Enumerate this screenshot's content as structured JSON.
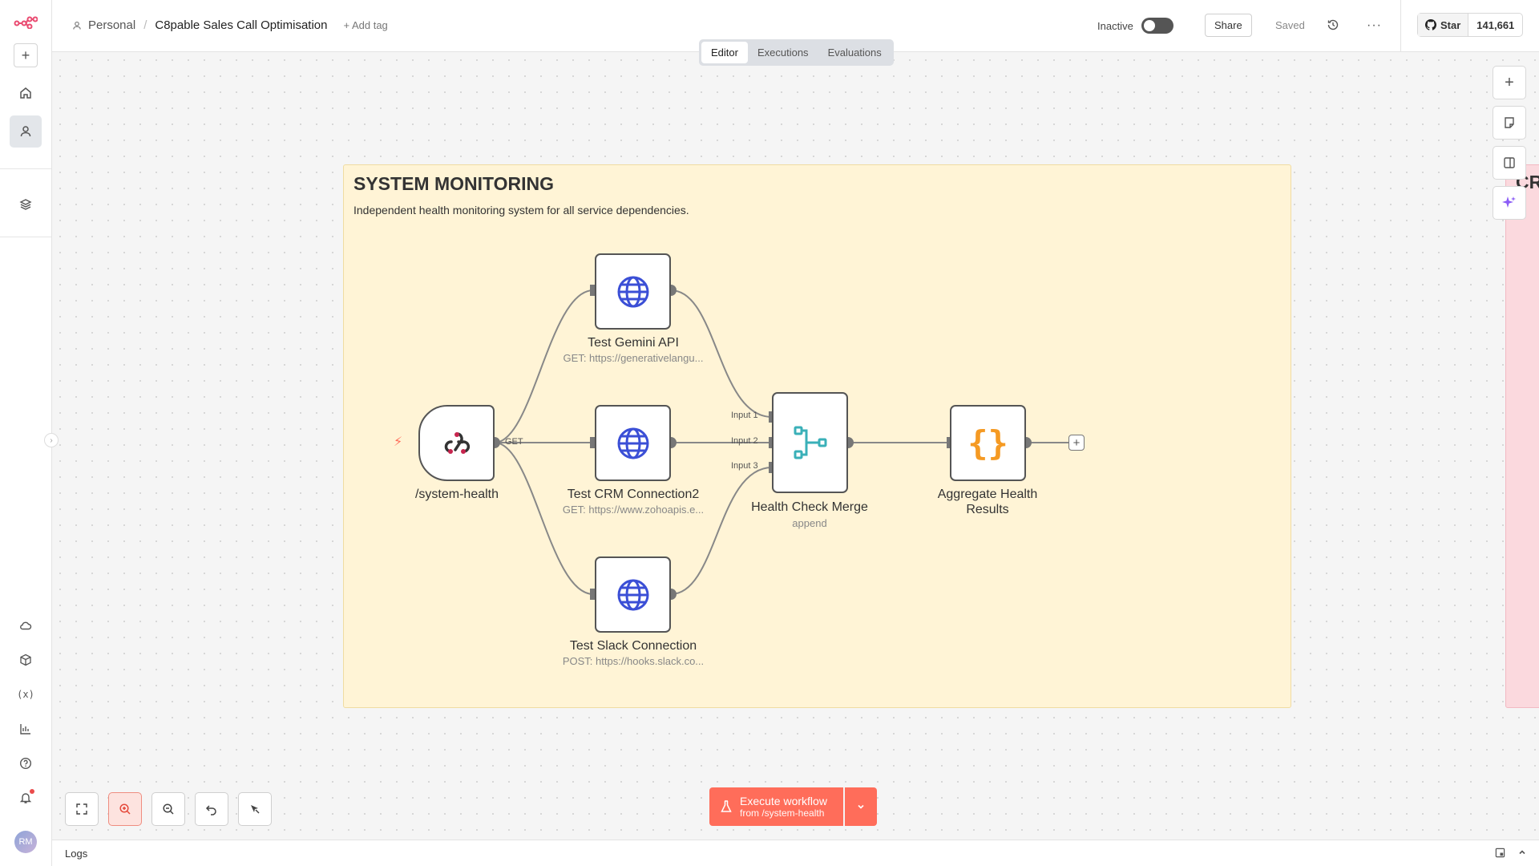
{
  "header": {
    "project": "Personal",
    "workflow_title": "C8pable Sales Call Optimisation",
    "add_tag": "+ Add tag",
    "status_label": "Inactive",
    "share": "Share",
    "saved": "Saved",
    "github_star": "Star",
    "github_count": "141,661"
  },
  "tabs": [
    {
      "label": "Editor",
      "active": true
    },
    {
      "label": "Executions",
      "active": false
    },
    {
      "label": "Evaluations",
      "active": false
    }
  ],
  "sticky": {
    "title": "SYSTEM MONITORING",
    "description": "Independent health monitoring system for all service dependencies.",
    "pink_title_partial": "CR"
  },
  "nodes": {
    "trigger": {
      "label": "/system-health",
      "method": "GET",
      "icon": "webhook-icon"
    },
    "gemini": {
      "label": "Test Gemini API",
      "sub": "GET: https://generativelangu...",
      "icon": "globe-icon"
    },
    "crm": {
      "label": "Test CRM Connection2",
      "sub": "GET: https://www.zohoapis.e...",
      "icon": "globe-icon"
    },
    "slack": {
      "label": "Test Slack Connection",
      "sub": "POST: https://hooks.slack.co...",
      "icon": "globe-icon"
    },
    "merge": {
      "label": "Health Check Merge",
      "sub": "append",
      "inputs": [
        "Input 1",
        "Input 2",
        "Input 3"
      ],
      "icon": "merge-icon"
    },
    "aggregate": {
      "label": "Aggregate Health Results",
      "icon": "code-braces-icon"
    }
  },
  "execute": {
    "label": "Execute workflow",
    "from": "from /system-health"
  },
  "logs": {
    "label": "Logs"
  },
  "sidebar": {
    "avatar_initials": "RM"
  },
  "colors": {
    "accent": "#ff6d5a",
    "sticky_yellow": "#fff4d6",
    "sticky_pink": "#fbd9de",
    "globe_blue": "#3b4fd6",
    "merge_teal": "#3ab0b8",
    "code_orange": "#f59a23",
    "ai_purple": "#8b5cf6"
  }
}
